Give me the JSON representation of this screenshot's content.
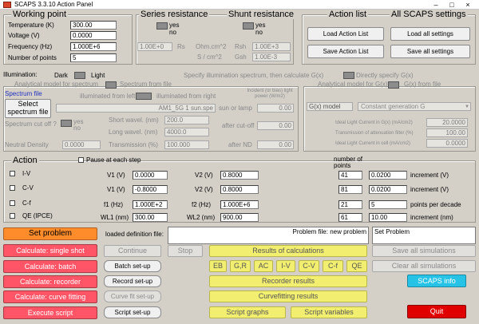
{
  "window": {
    "title": "SCAPS 3.3.10 Action Panel",
    "controls": [
      "–",
      "□",
      "×"
    ]
  },
  "working_point": {
    "title": "Working point",
    "rows": [
      {
        "label": "Temperature (K)",
        "value": "300.00"
      },
      {
        "label": "Voltage (V)",
        "value": "0.0000"
      },
      {
        "label": "Frequency (Hz)",
        "value": "1.000E+6"
      },
      {
        "label": "Number of points",
        "value": "5"
      }
    ]
  },
  "series_resistance": {
    "title": "Series resistance",
    "yes": "yes",
    "no": "no",
    "rs_value": "1.00E+0",
    "rs_label": "Rs",
    "unit1": "Ohm.cm^2",
    "unit2": "S / cm^2"
  },
  "shunt_resistance": {
    "title": "Shunt resistance",
    "yes": "yes",
    "no": "no",
    "rsh_label": "Rsh",
    "rsh_value": "1.00E+3",
    "gsh_label": "Gsh",
    "gsh_value": "1.00E-3"
  },
  "action_list": {
    "title": "Action list",
    "load": "Load Action List",
    "save": "Save Action List"
  },
  "all_settings": {
    "title": "All SCAPS settings",
    "load": "Load all settings",
    "save": "Save all settings"
  },
  "illumination": {
    "label": "Illumination:",
    "dark": "Dark",
    "light": "Light",
    "specify": "Specify illumination spectrum, then calculate G(x)",
    "directly": "Directly specify G(x)"
  },
  "spectrum": {
    "tab_model": "Analytical model for spectrum",
    "tab_file": "Spectrum from file",
    "spectrum_file_label": "Spectrum file",
    "select_button": "Select spectrum file",
    "from_left": "illuminated from left",
    "from_right": "illuminated from right",
    "file_value": "AM1_5G 1 sun.spe",
    "incident_label": "Incident (or bias) light power (W/m2)",
    "sun_or_lamp": "sun or lamp",
    "sun_value": "0.00",
    "cutoff_label": "Spectrum cut off ?",
    "yes": "yes",
    "no": "no",
    "short_label": "Short wavel. (nm)",
    "short_value": "200.0",
    "long_label": "Long wavel. (nm)",
    "long_value": "4000.0",
    "after_cutoff": "after cut-off",
    "after_cutoff_value": "0.00",
    "nd_label": "Neutral Density",
    "nd_value": "0.0000",
    "trans_label": "Transmission (%)",
    "trans_value": "100.000",
    "after_nd": "after ND",
    "after_nd_value": "0.00"
  },
  "gx": {
    "tab_model": "Analytical model for G(x)",
    "tab_file": "G(x) from file",
    "model_label": "G(x) model",
    "model_value": "Constant generation G",
    "ideal_label": "Ideal Light Current in G(x) (mA/cm2)",
    "ideal_value": "20.0000",
    "atten_label": "Transmission of attenuation filter (%)",
    "atten_value": "100.00",
    "cell_label": "Ideal Light Current in cell (mA/cm2)",
    "cell_value": "0.0000"
  },
  "action": {
    "title": "Action",
    "pause": "Pause at each step",
    "points_header": "number of points",
    "rows": [
      {
        "name": "I-V",
        "l1": "V1 (V)",
        "v1": "0.0000",
        "l2": "V2 (V)",
        "v2": "0.8000",
        "n": "41",
        "inc": "0.0200",
        "inc_label": "increment (V)"
      },
      {
        "name": "C-V",
        "l1": "V1 (V)",
        "v1": "-0.8000",
        "l2": "V2 (V)",
        "v2": "0.8000",
        "n": "81",
        "inc": "0.0200",
        "inc_label": "increment (V)"
      },
      {
        "name": "C-f",
        "l1": "f1 (Hz)",
        "v1": "1.000E+2",
        "l2": "f2 (Hz)",
        "v2": "1.000E+6",
        "n": "21",
        "inc": "5",
        "inc_label": "points per decade"
      },
      {
        "name": "QE (IPCE)",
        "l1": "WL1 (nm)",
        "v1": "300.00",
        "l2": "WL2 (nm)",
        "v2": "900.00",
        "n": "61",
        "inc": "10.00",
        "inc_label": "increment (nm)"
      }
    ]
  },
  "bottom": {
    "set_problem": "Set problem",
    "loaded_label": "loaded definition file:",
    "problem_file": "Problem file: new problem",
    "set_problem_status": "Set Problem",
    "calc_single": "Calculate: single shot",
    "continue": "Continue",
    "stop": "Stop",
    "results": "Results of calculations",
    "save_all": "Save all simulations",
    "calc_batch": "Calculate: batch",
    "batch_setup": "Batch set-up",
    "result_tabs": [
      "EB",
      "G,R",
      "AC",
      "I-V",
      "C-V",
      "C-f",
      "QE"
    ],
    "clear_all": "Clear all simulations",
    "calc_recorder": "Calculate: recorder",
    "record_setup": "Record set-up",
    "recorder_results": "Recorder results",
    "scaps_info": "SCAPS info",
    "calc_curve": "Calculate: curve fitting",
    "curve_setup": "Curve fit set-up",
    "curvefit_results": "Curvefitting results",
    "execute": "Execute script",
    "script_setup": "Script set-up",
    "script_graphs": "Script graphs",
    "script_vars": "Script variables",
    "quit": "Quit"
  }
}
